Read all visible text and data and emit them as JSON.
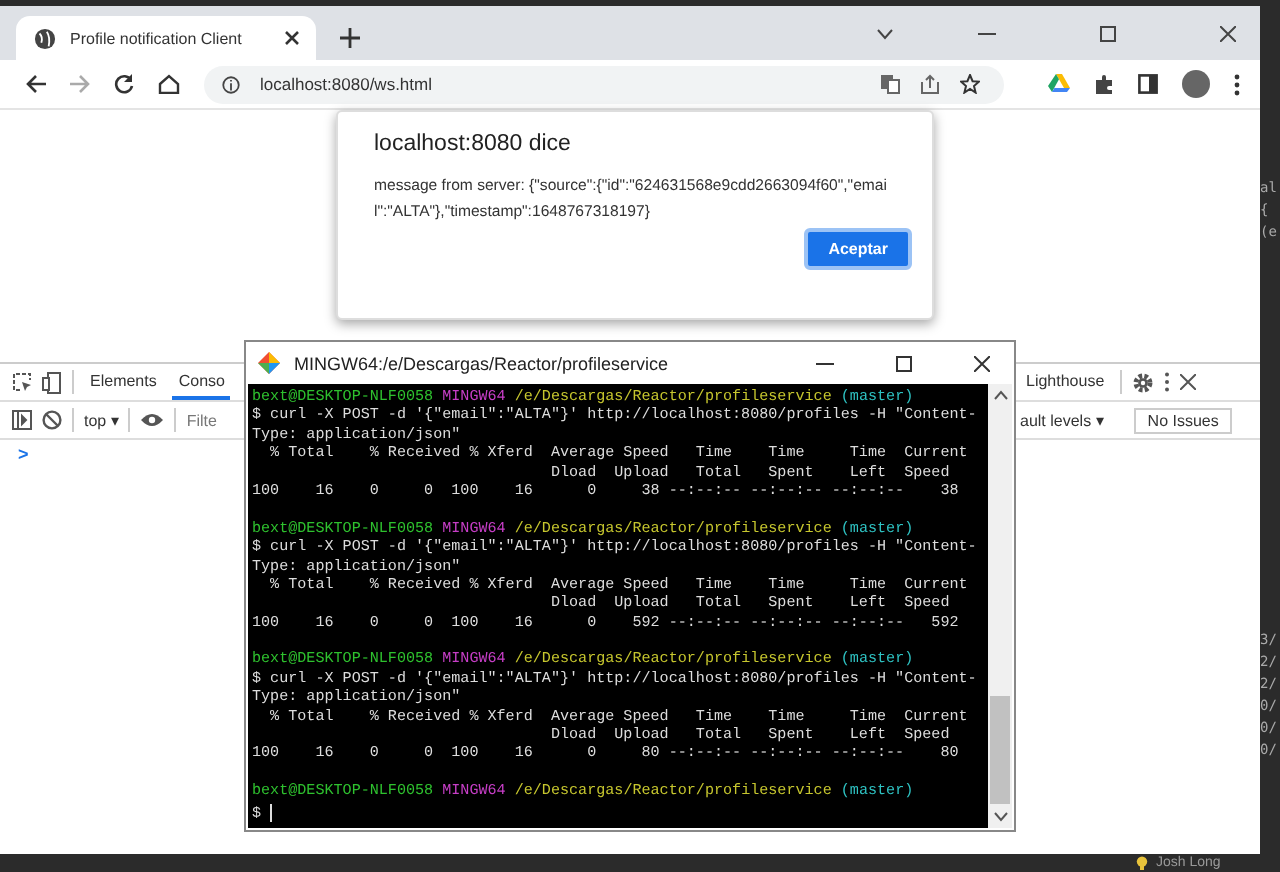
{
  "browser": {
    "tab": {
      "title": "Profile notification Client",
      "selected": true
    },
    "url": "localhost:8080/ws.html"
  },
  "dialog": {
    "title": "localhost:8080 dice",
    "message": "message from server: {\"source\":{\"id\":\"624631568e9cdd2663094f60\",\"email\":\"ALTA\"},\"timestamp\":1648767318197}",
    "button": "Aceptar"
  },
  "devtools": {
    "tabs": [
      {
        "label": "Elements",
        "selected": false
      },
      {
        "label": "Conso",
        "selected": true
      }
    ],
    "tabs_right": [
      {
        "label": "Lighthouse",
        "selected": false
      }
    ],
    "context": "top ▾",
    "filter": {
      "placeholder": "Filte"
    },
    "levels": "ault levels ▾",
    "issues": "No Issues",
    "prompt": ">"
  },
  "terminal": {
    "title": "MINGW64:/e/Descargas/Reactor/profileservice",
    "lines": [
      {
        "kind": "prompt",
        "user": "bext@DESKTOP-NLF0058",
        "system": "MINGW64",
        "path": "/e/Descargas/Reactor/profileservice",
        "branch": "(master)"
      },
      {
        "kind": "text",
        "text": "$ curl -X POST -d '{\"email\":\"ALTA\"}' http://localhost:8080/profiles -H \"Content-"
      },
      {
        "kind": "text",
        "text": "Type: application/json\""
      },
      {
        "kind": "text",
        "text": "  % Total    % Received % Xferd  Average Speed   Time    Time     Time  Current"
      },
      {
        "kind": "text",
        "text": "                                 Dload  Upload   Total   Spent    Left  Speed"
      },
      {
        "kind": "text",
        "text": "100    16    0     0  100    16      0     38 --:--:-- --:--:-- --:--:--    38"
      },
      {
        "kind": "blank"
      },
      {
        "kind": "prompt",
        "user": "bext@DESKTOP-NLF0058",
        "system": "MINGW64",
        "path": "/e/Descargas/Reactor/profileservice",
        "branch": "(master)"
      },
      {
        "kind": "text",
        "text": "$ curl -X POST -d '{\"email\":\"ALTA\"}' http://localhost:8080/profiles -H \"Content-"
      },
      {
        "kind": "text",
        "text": "Type: application/json\""
      },
      {
        "kind": "text",
        "text": "  % Total    % Received % Xferd  Average Speed   Time    Time     Time  Current"
      },
      {
        "kind": "text",
        "text": "                                 Dload  Upload   Total   Spent    Left  Speed"
      },
      {
        "kind": "text",
        "text": "100    16    0     0  100    16      0    592 --:--:-- --:--:-- --:--:--   592"
      },
      {
        "kind": "blank"
      },
      {
        "kind": "prompt",
        "user": "bext@DESKTOP-NLF0058",
        "system": "MINGW64",
        "path": "/e/Descargas/Reactor/profileservice",
        "branch": "(master)"
      },
      {
        "kind": "text",
        "text": "$ curl -X POST -d '{\"email\":\"ALTA\"}' http://localhost:8080/profiles -H \"Content-"
      },
      {
        "kind": "text",
        "text": "Type: application/json\""
      },
      {
        "kind": "text",
        "text": "  % Total    % Received % Xferd  Average Speed   Time    Time     Time  Current"
      },
      {
        "kind": "text",
        "text": "                                 Dload  Upload   Total   Spent    Left  Speed"
      },
      {
        "kind": "text",
        "text": "100    16    0     0  100    16      0     80 --:--:-- --:--:-- --:--:--    80"
      },
      {
        "kind": "blank"
      },
      {
        "kind": "prompt",
        "user": "bext@DESKTOP-NLF0058",
        "system": "MINGW64",
        "path": "/e/Descargas/Reactor/profileservice",
        "branch": "(master)"
      },
      {
        "kind": "input",
        "text": "$"
      }
    ]
  },
  "ide": {
    "fragments": [
      "al",
      "{",
      "(e"
    ],
    "dates": [
      "3/",
      "2/",
      "2/",
      "0/",
      "0/",
      "0/"
    ],
    "author": "Josh Long"
  }
}
